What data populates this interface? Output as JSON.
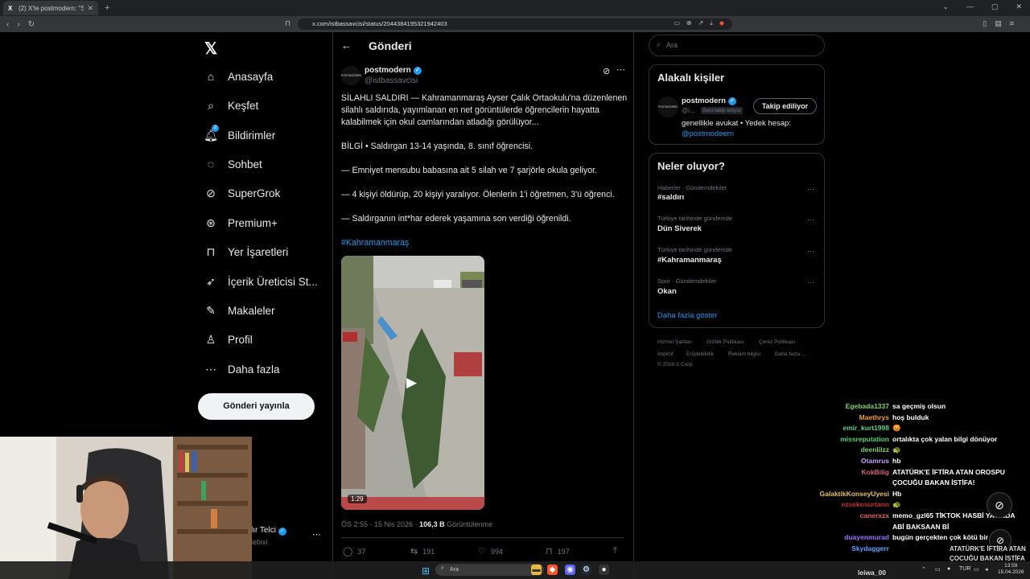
{
  "browser": {
    "tab_title": "(2) X'te postmodern: \"SİLAHLI SA...",
    "url": "x.com/istbassavcisi/status/2044384195321942403"
  },
  "nav": {
    "items": [
      {
        "label": "Anasayfa",
        "icon": "home-icon"
      },
      {
        "label": "Keşfet",
        "icon": "search-icon"
      },
      {
        "label": "Bildirimler",
        "icon": "bell-icon",
        "badge": "2"
      },
      {
        "label": "Sohbet",
        "icon": "chat-icon"
      },
      {
        "label": "SuperGrok",
        "icon": "grok-icon"
      },
      {
        "label": "Premium+",
        "icon": "x-circle-icon"
      },
      {
        "label": "Yer İşaretleri",
        "icon": "bookmark-icon"
      },
      {
        "label": "İçerik Üreticisi St...",
        "icon": "rocket-icon"
      },
      {
        "label": "Makaleler",
        "icon": "article-icon"
      },
      {
        "label": "Profil",
        "icon": "person-icon"
      },
      {
        "label": "Daha fazla",
        "icon": "more-circle-icon"
      }
    ],
    "post_button": "Gönderi yayınla",
    "account_name": "lır Telci",
    "account_handle": "lebixi"
  },
  "main": {
    "header_title": "Gönderi",
    "author_name": "postmodern",
    "author_handle": "@istbassavcisi",
    "avatar_text": "POSTMODERN",
    "tweet_lines": [
      "SİLAHLI SALDIRI — Kahramanmaraş Ayser Çalık Ortaokulu'na düzenlenen silahlı saldırıda, yayımlanan en net görüntülerde öğrencilerin hayatta kalabilmek için okul camlarından atladığı görülüyor...",
      "BİLGİ • Saldırgan 13-14 yaşında, 8. sınıf öğrencisi.",
      "— Emniyet mensubu babasına ait 5 silah ve 7 şarjörle okula geliyor.",
      "— 4 kişiyi öldürüp, 20 kişiyi yaralıyor. Ölenlerin 1'i öğretmen, 3'ü öğrenci.",
      "— Saldırganın int*har ederek yaşamına son verdiği öğrenildi."
    ],
    "hashtag": "#Kahramanmaraş",
    "video_duration": "1:29",
    "timestamp": "ÖS 2:55 · 15 Nis 2026 · ",
    "views_count": "106,3 B",
    "views_label": " Görüntülenme",
    "actions": {
      "replies": "37",
      "reposts": "191",
      "likes": "994",
      "bookmarks": "197"
    }
  },
  "right": {
    "search_placeholder": "Ara",
    "related_title": "Alakalı kişiler",
    "related_name": "postmodern",
    "related_handle": "@i...",
    "related_tag": "Seni takip ediyor",
    "follow_button": "Takip ediliyor",
    "related_bio": "genellikle avukat • Yedek hesap:",
    "related_link": "@postmodeern",
    "trends_title": "Neler oluyor?",
    "trends": [
      {
        "category": "Haberler · Gündemdekiler",
        "name": "#saldırı"
      },
      {
        "category": "Türkiye tarihinde gündemde",
        "name": "Dün Siverek"
      },
      {
        "category": "Türkiye tarihinde gündemde",
        "name": "#Kahramanmaraş"
      },
      {
        "category": "Spor · Gündemdekiler",
        "name": "Okan"
      }
    ],
    "show_more": "Daha fazla göster",
    "footer": [
      "Hizmet Şartları",
      "Gizlilik Politikası",
      "Çerez Politikası",
      "İmprint",
      "Erişilebilirlik",
      "Reklam bilgisi",
      "Daha fazla ...",
      "© 2026 X Corp."
    ]
  },
  "chat": [
    {
      "user": "Egebada1337",
      "msg": "sa geçmiş olsun",
      "color": "#7fd36b"
    },
    {
      "user": "Maethrys",
      "msg": "hoş bulduk",
      "color": "#f0a030"
    },
    {
      "user": "emir_kurt1998",
      "msg": "😡",
      "color": "#5fd38b"
    },
    {
      "user": "missreputation",
      "msg": "ortalıkta çok yalan bilgi dönüyor",
      "color": "#55d07a"
    },
    {
      "user": "deenlilzz",
      "msg": "🐢",
      "color": "#7fd36b"
    },
    {
      "user": "Otamrus",
      "msg": "hb",
      "color": "#c9a0ff"
    },
    {
      "user": "KokBilig",
      "msg": "ATATÜRK'E İFTİRA ATAN OROSPU",
      "msg2": "ÇOCUĞU BAKAN İSTİFA!",
      "color": "#d06080"
    },
    {
      "user": "GalaktikKonseyUyesi",
      "msg": "Hb",
      "color": "#e8c060"
    },
    {
      "user": "ezsekosurtann",
      "msg": "🐢",
      "color": "#c03030"
    },
    {
      "user": "canerxzx",
      "msg": "memo_gzl65 TİKTOK HASBİ YAYINDA",
      "msg2": "ABİ BAKSAAN Bİ",
      "color": "#e06070"
    },
    {
      "user": "duayenmurad",
      "msg": "bugün gerçekten çok kötü bir gün",
      "color": "#a070ff"
    },
    {
      "user": "Skydaggerr",
      "msg": "",
      "color": "#60a0ff"
    }
  ],
  "overlay": {
    "line1": "ATATÜRK'E İFTİRA ATAN",
    "line2": "ÇOCUĞU BAKAN İSTİFA"
  },
  "taskbar": {
    "search": "Ara",
    "lang": "TUR",
    "time": "13:59",
    "date": "15.04.2026",
    "streamer": "leiwa_00"
  }
}
